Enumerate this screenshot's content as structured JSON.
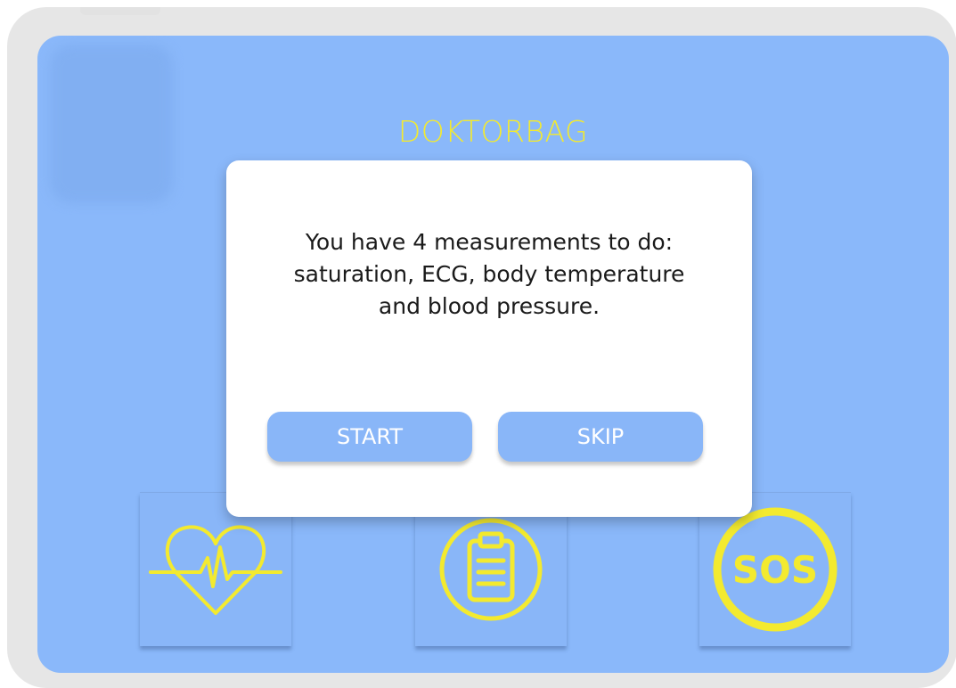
{
  "app": {
    "title": "DOKTORBAG"
  },
  "dialog": {
    "message": "You have 4 measurements to do: saturation, ECG, body temperature and blood pressure.",
    "start_label": "START",
    "skip_label": "SKIP"
  },
  "tiles": [
    {
      "icon": "heart-rate-icon"
    },
    {
      "icon": "clipboard-icon"
    },
    {
      "icon": "sos-icon",
      "label": "SOS"
    }
  ],
  "colors": {
    "screen_background": "#8ab8fa",
    "accent_yellow": "#f3ea2f",
    "button": "#89b6f8",
    "dialog": "#ffffff"
  }
}
